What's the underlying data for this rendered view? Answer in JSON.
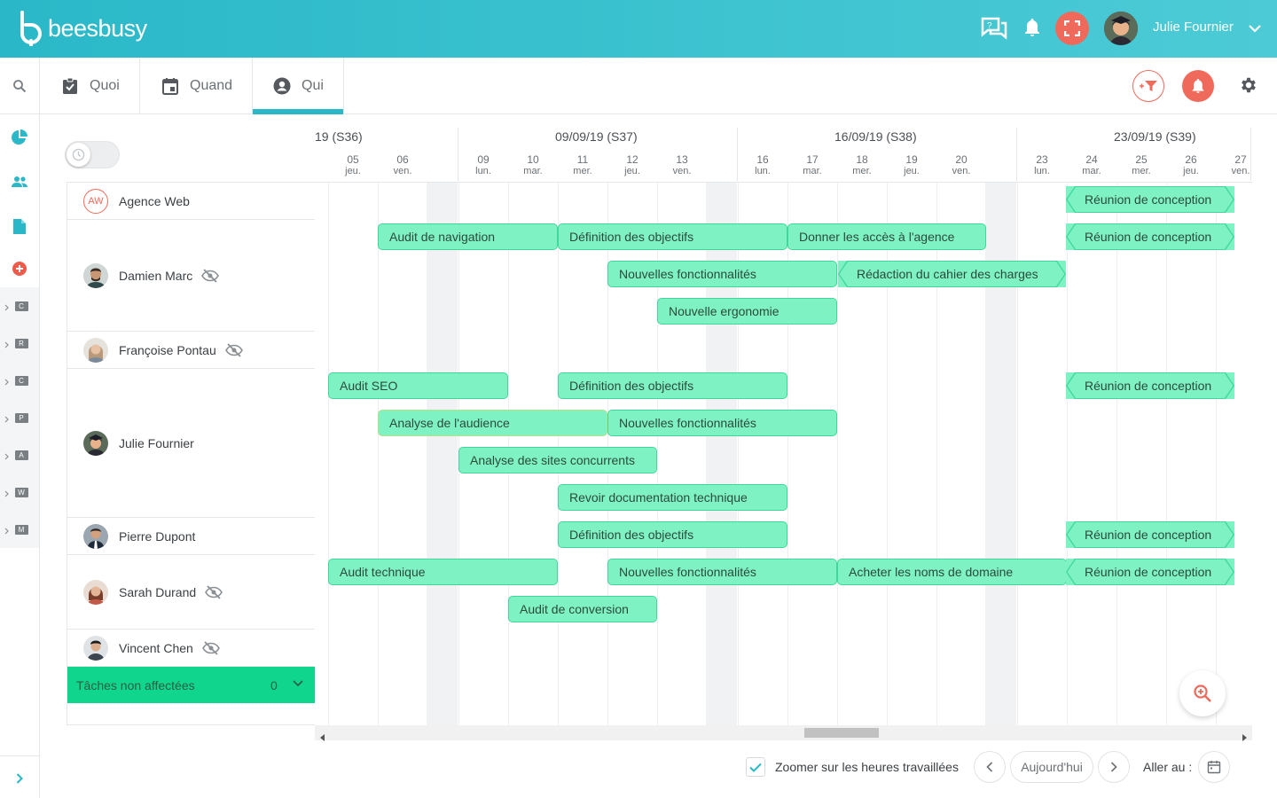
{
  "app": {
    "name": "beesbusy"
  },
  "header": {
    "user_name": "Julie Fournier"
  },
  "tabs": [
    {
      "label": "Quoi",
      "icon": "clipboard-check-icon"
    },
    {
      "label": "Quand",
      "icon": "calendar-icon"
    },
    {
      "label": "Qui",
      "icon": "user-circle-icon",
      "active": true
    }
  ],
  "sidebar": {
    "projects": [
      "C",
      "R",
      "C",
      "P",
      "A",
      "W",
      "M"
    ]
  },
  "timeline": {
    "weeks": [
      "19 (S36)",
      "09/09/19 (S37)",
      "16/09/19 (S38)",
      "23/09/19 (S39)"
    ],
    "days": [
      {
        "num": "05",
        "wd": "jeu."
      },
      {
        "num": "06",
        "wd": "ven."
      },
      {
        "num": "09",
        "wd": "lun."
      },
      {
        "num": "10",
        "wd": "mar."
      },
      {
        "num": "11",
        "wd": "mer."
      },
      {
        "num": "12",
        "wd": "jeu."
      },
      {
        "num": "13",
        "wd": "ven."
      },
      {
        "num": "16",
        "wd": "lun."
      },
      {
        "num": "17",
        "wd": "mar."
      },
      {
        "num": "18",
        "wd": "mer."
      },
      {
        "num": "19",
        "wd": "jeu."
      },
      {
        "num": "20",
        "wd": "ven."
      },
      {
        "num": "23",
        "wd": "lun."
      },
      {
        "num": "24",
        "wd": "mar."
      },
      {
        "num": "25",
        "wd": "mer."
      },
      {
        "num": "26",
        "wd": "jeu."
      },
      {
        "num": "27",
        "wd": "ven."
      }
    ]
  },
  "people": [
    {
      "name": "Agence Web",
      "initials": "AW",
      "hidden": false
    },
    {
      "name": "Damien Marc",
      "hidden": true
    },
    {
      "name": "Françoise Pontau",
      "hidden": true
    },
    {
      "name": "Julie Fournier",
      "hidden": false
    },
    {
      "name": "Pierre Dupont",
      "hidden": false
    },
    {
      "name": "Sarah Durand",
      "hidden": true
    },
    {
      "name": "Vincent Chen",
      "hidden": true
    }
  ],
  "unassigned": {
    "label": "Tâches non affectées",
    "count": "0"
  },
  "tasks": [
    {
      "label": "Réunion de conception",
      "start": "24",
      "end": "27",
      "lane": 0
    },
    {
      "label": "Audit de navigation",
      "start": "06",
      "end": "10",
      "lane": 1
    },
    {
      "label": "Définition des objectifs",
      "start": "11",
      "end": "16",
      "lane": 1
    },
    {
      "label": "Donner les accès à l'agence",
      "start": "17",
      "end": "20",
      "lane": 1
    },
    {
      "label": "Réunion de conception",
      "start": "24",
      "end": "27",
      "lane": 1
    },
    {
      "label": "Nouvelles fonctionnalités",
      "start": "12",
      "end": "17",
      "lane": 2
    },
    {
      "label": "Rédaction du cahier des charges",
      "start": "18",
      "end": "23",
      "lane": 2
    },
    {
      "label": "Nouvelle ergonomie",
      "start": "13",
      "end": "17",
      "lane": 3
    },
    {
      "label": "Audit SEO",
      "start": "05",
      "end": "09",
      "lane": 5
    },
    {
      "label": "Définition des objectifs",
      "start": "11",
      "end": "16",
      "lane": 5
    },
    {
      "label": "Réunion de conception",
      "start": "24",
      "end": "27",
      "lane": 5
    },
    {
      "label": "Analyse de l'audience",
      "start": "06",
      "end": "11",
      "lane": 6
    },
    {
      "label": "Nouvelles fonctionnalités",
      "start": "12",
      "end": "17",
      "lane": 6
    },
    {
      "label": "Analyse des sites concurrents",
      "start": "09",
      "end": "12",
      "lane": 7
    },
    {
      "label": "Revoir documentation technique",
      "start": "11",
      "end": "16",
      "lane": 8
    },
    {
      "label": "Définition des objectifs",
      "start": "11",
      "end": "16",
      "lane": 9
    },
    {
      "label": "Réunion de conception",
      "start": "24",
      "end": "27",
      "lane": 9
    },
    {
      "label": "Audit technique",
      "start": "05",
      "end": "10",
      "lane": 10
    },
    {
      "label": "Nouvelles fonctionnalités",
      "start": "12",
      "end": "17",
      "lane": 10
    },
    {
      "label": "Acheter les noms de domaine",
      "start": "18",
      "end": "23",
      "lane": 10
    },
    {
      "label": "Réunion de conception",
      "start": "24",
      "end": "27",
      "lane": 10
    },
    {
      "label": "Audit de conversion",
      "start": "10",
      "end": "12",
      "lane": 11
    }
  ],
  "footer": {
    "zoom_label": "Zoomer sur les heures travaillées",
    "today_label": "Aujourd'hui",
    "goto_label": "Aller au :"
  },
  "colors": {
    "accent": "#2ab8c8",
    "task_fill": "#7ff2c4",
    "task_border": "#3fd89a",
    "danger": "#ef6a5a",
    "unassigned": "#0fd68c"
  }
}
